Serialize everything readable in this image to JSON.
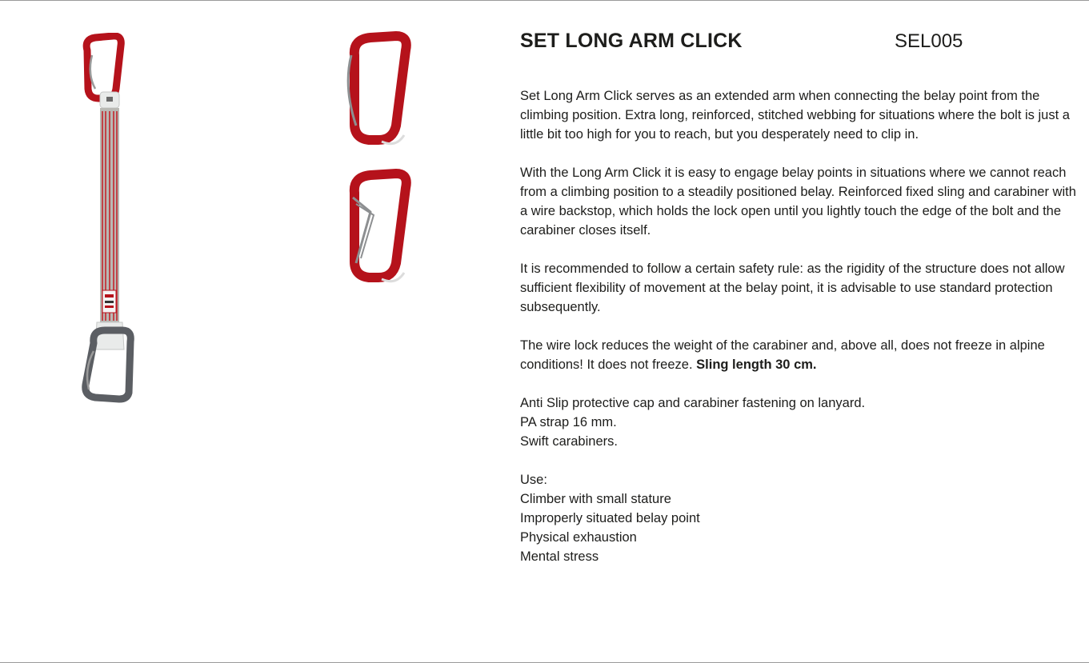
{
  "product": {
    "title": "SET LONG ARM CLICK",
    "code": "SEL005"
  },
  "description": {
    "p1": "Set Long Arm Click  serves as an extended arm when connecting the belay point from the climbing position. Extra long, reinforced, stitched webbing for situations where the bolt is just a little bit too high for you to reach, but you desperately need to clip in.",
    "p2": "With the Long Arm Click it is easy to engage belay points in situations where we cannot reach from a climbing position to a steadily positioned belay. Reinforced fixed sling and carabiner with a wire backstop, which  holds the lock open until you lightly touch the edge of the bolt and the carabiner closes itself.",
    "p3": "It is recommended to follow a certain safety rule: as the rigidity of the structure does not allow sufficient flexibility of movement at the belay point, it is advisable to use standard protection subsequently.",
    "p4_text": "The wire lock reduces the weight of the carabiner and, above all, does not freeze in alpine conditions! It does not freeze. ",
    "p4_bold": "Sling length 30 cm.",
    "features": [
      "Anti Slip protective cap and carabiner fastening on lanyard.",
      "PA strap 16 mm.",
      "Swift carabiners."
    ],
    "use_heading": "Use:",
    "use_items": [
      "Climber with small stature",
      "Improperly situated belay point",
      "Physical exhaustion",
      "Mental stress"
    ]
  },
  "images": {
    "left": "quickdraw-long-arm-icon",
    "center_top": "red-carabiner-closed-icon",
    "center_bottom": "red-carabiner-open-gate-icon",
    "colors": {
      "carabiner_red": "#b5121b",
      "carabiner_grey": "#5b5e63",
      "sling_grey": "#b9b9b4",
      "sling_red": "#c3262c"
    }
  }
}
